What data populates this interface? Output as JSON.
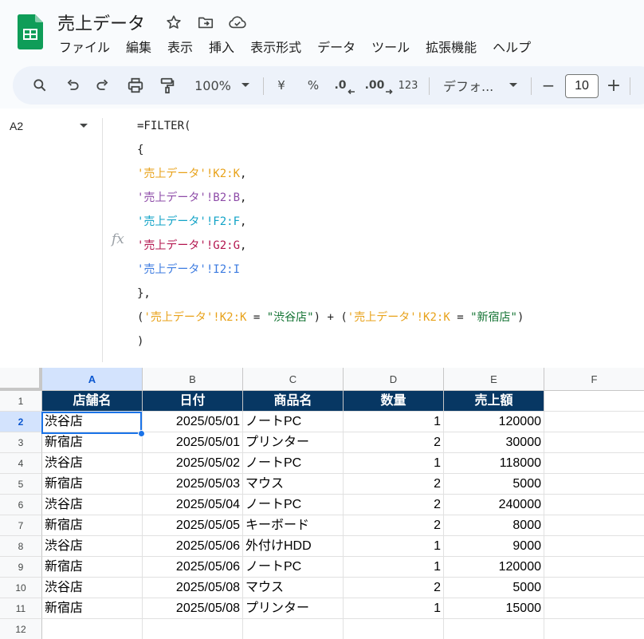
{
  "doc": {
    "title": "売上データ",
    "icons": [
      "star-icon",
      "move-to-folder-icon",
      "cloud-saved-icon"
    ]
  },
  "menu": [
    "ファイル",
    "編集",
    "表示",
    "挿入",
    "表示形式",
    "データ",
    "ツール",
    "拡張機能",
    "ヘルプ"
  ],
  "toolbar": {
    "zoom": "100%",
    "currency": "¥",
    "percent": "%",
    "decrease_decimal": ".0",
    "increase_decimal": ".00",
    "more_formats": "123",
    "font": "デフォ...",
    "font_size": "10",
    "minus": "−",
    "plus": "+"
  },
  "formula_bar": {
    "name_box": "A2",
    "fx": "fx",
    "lines": [
      [
        {
          "t": "=FILTER(",
          "c": "#1f1f1f"
        }
      ],
      [
        {
          "t": "{",
          "c": "#1f1f1f"
        }
      ],
      [
        {
          "t": "'売上データ'!K2:K",
          "c": "#e8a21a"
        },
        {
          "t": ",",
          "c": "#1f1f1f"
        }
      ],
      [
        {
          "t": "'売上データ'!B2:B",
          "c": "#8e4ca8"
        },
        {
          "t": ",",
          "c": "#1f1f1f"
        }
      ],
      [
        {
          "t": "'売上データ'!F2:F",
          "c": "#12a3c7"
        },
        {
          "t": ",",
          "c": "#1f1f1f"
        }
      ],
      [
        {
          "t": "'売上データ'!G2:G",
          "c": "#b3164f"
        },
        {
          "t": ",",
          "c": "#1f1f1f"
        }
      ],
      [
        {
          "t": "'売上データ'!I2:I",
          "c": "#3c7be0"
        }
      ],
      [
        {
          "t": "},",
          "c": "#1f1f1f"
        }
      ],
      [
        {
          "t": "(",
          "c": "#1f1f1f"
        },
        {
          "t": "'売上データ'!K2:K",
          "c": "#e8a21a"
        },
        {
          "t": " = ",
          "c": "#1f1f1f"
        },
        {
          "t": "\"渋谷店\"",
          "c": "#137333"
        },
        {
          "t": ") + (",
          "c": "#1f1f1f"
        },
        {
          "t": "'売上データ'!K2:K",
          "c": "#e8a21a"
        },
        {
          "t": " = ",
          "c": "#1f1f1f"
        },
        {
          "t": "\"新宿店\"",
          "c": "#137333"
        },
        {
          "t": ")",
          "c": "#1f1f1f"
        }
      ],
      [
        {
          "t": ")",
          "c": "#1f1f1f"
        }
      ]
    ]
  },
  "grid": {
    "columns": [
      "A",
      "B",
      "C",
      "D",
      "E",
      "F"
    ],
    "active_column": "A",
    "active_row": "2",
    "rows": [
      {
        "n": "1",
        "cells": [
          "店舗名",
          "日付",
          "商品名",
          "数量",
          "売上額",
          ""
        ]
      },
      {
        "n": "2",
        "cells": [
          "渋谷店",
          "2025/05/01",
          "ノートPC",
          "1",
          "120000",
          ""
        ]
      },
      {
        "n": "3",
        "cells": [
          "新宿店",
          "2025/05/01",
          "プリンター",
          "2",
          "30000",
          ""
        ]
      },
      {
        "n": "4",
        "cells": [
          "渋谷店",
          "2025/05/02",
          "ノートPC",
          "1",
          "118000",
          ""
        ]
      },
      {
        "n": "5",
        "cells": [
          "新宿店",
          "2025/05/03",
          "マウス",
          "2",
          "5000",
          ""
        ]
      },
      {
        "n": "6",
        "cells": [
          "渋谷店",
          "2025/05/04",
          "ノートPC",
          "2",
          "240000",
          ""
        ]
      },
      {
        "n": "7",
        "cells": [
          "新宿店",
          "2025/05/05",
          "キーボード",
          "2",
          "8000",
          ""
        ]
      },
      {
        "n": "8",
        "cells": [
          "渋谷店",
          "2025/05/06",
          "外付けHDD",
          "1",
          "9000",
          ""
        ]
      },
      {
        "n": "9",
        "cells": [
          "新宿店",
          "2025/05/06",
          "ノートPC",
          "1",
          "120000",
          ""
        ]
      },
      {
        "n": "10",
        "cells": [
          "渋谷店",
          "2025/05/08",
          "マウス",
          "2",
          "5000",
          ""
        ]
      },
      {
        "n": "11",
        "cells": [
          "新宿店",
          "2025/05/08",
          "プリンター",
          "1",
          "15000",
          ""
        ]
      },
      {
        "n": "12",
        "cells": [
          "",
          "",
          "",
          "",
          "",
          ""
        ]
      }
    ]
  },
  "colors": {
    "header_fill": "#073763",
    "selection": "#1a73e8",
    "logo_green": "#0f9d58"
  }
}
